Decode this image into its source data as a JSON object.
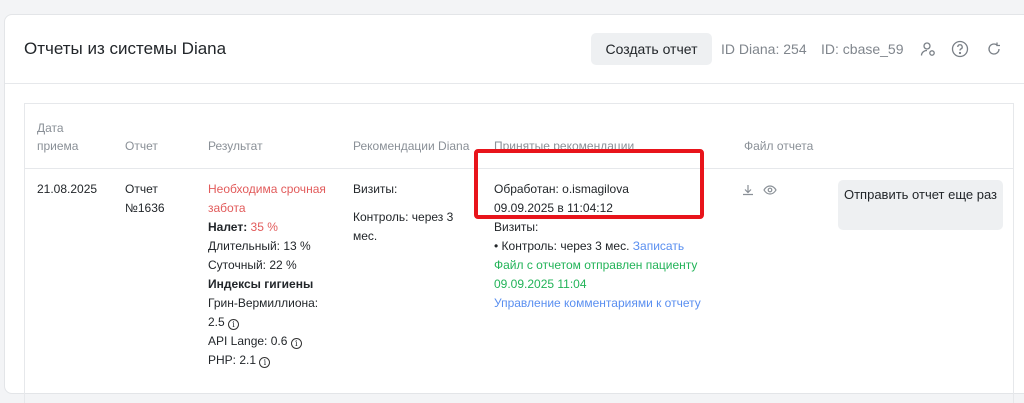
{
  "header": {
    "title": "Отчеты из системы Diana",
    "create_button": "Создать отчет",
    "id_diana": "ID Diana: 254",
    "id_cbase": "ID: cbase_59",
    "icons": [
      "user-settings-icon",
      "help-icon",
      "refresh-icon"
    ]
  },
  "table": {
    "columns": [
      "Дата приема",
      "Отчет",
      "Результат",
      "Рекомендации Diana",
      "Принятые рекомендации",
      "Файл отчета"
    ],
    "row": {
      "date": "21.08.2025",
      "report": "Отчет №1636",
      "result": {
        "urgent": "Необходима срочная забота",
        "plaque_label": "Налет:",
        "plaque_value": "35 %",
        "long": "Длительный: 13 %",
        "daily": "Суточный: 22 %",
        "hygiene_title": "Индексы гигиены",
        "green_vermillion_label": "Грин-Вермиллиона:",
        "green_vermillion_value": "2.5",
        "api": "API Lange: 0.6",
        "php": "PHP: 2.1"
      },
      "diana_recs": {
        "visits": "Визиты:",
        "control": "Контроль: через 3 мес."
      },
      "accepted": {
        "processed_by": "Обработан: o.ismagilova",
        "processed_at": "09.09.2025 в 11:04:12",
        "visits": "Визиты:",
        "control": "• Контроль: через 3 мес.",
        "book_link": "Записать",
        "sent_line1": "Файл с отчетом отправлен пациенту",
        "sent_line2": "09.09.2025 11:04",
        "manage_comments": "Управление комментариями к отчету"
      },
      "file_icons": [
        "download-icon",
        "eye-icon"
      ],
      "resend_button": "Отправить отчет еще раз"
    }
  },
  "colors": {
    "urgent": "#e25b5b",
    "sent": "#22b358",
    "link": "#5a8ff0",
    "highlight": "#e8141b"
  }
}
